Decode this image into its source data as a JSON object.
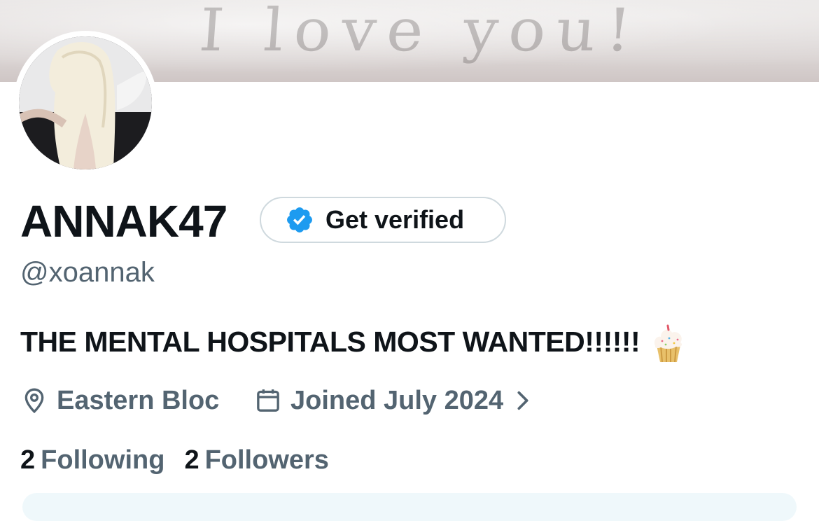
{
  "banner": {
    "text": "I love you!"
  },
  "profile": {
    "display_name": "ANNAK47",
    "get_verified_label": "Get verified",
    "handle": "@xoannak",
    "bio": "THE MENTAL HOSPITALS MOST WANTED!!!!!!",
    "bio_emoji": "cupcake",
    "location": "Eastern Bloc",
    "joined": "Joined July 2024",
    "following_count": "2",
    "following_label": "Following",
    "followers_count": "2",
    "followers_label": "Followers"
  },
  "icons": {
    "verify_badge": "verified-badge-icon",
    "location": "location-pin-icon",
    "calendar": "calendar-icon",
    "chevron": "chevron-right-icon"
  },
  "colors": {
    "text_primary": "#0f1419",
    "text_secondary": "#536471",
    "accent_blue": "#1d9bf0",
    "border": "#cfd9de"
  }
}
